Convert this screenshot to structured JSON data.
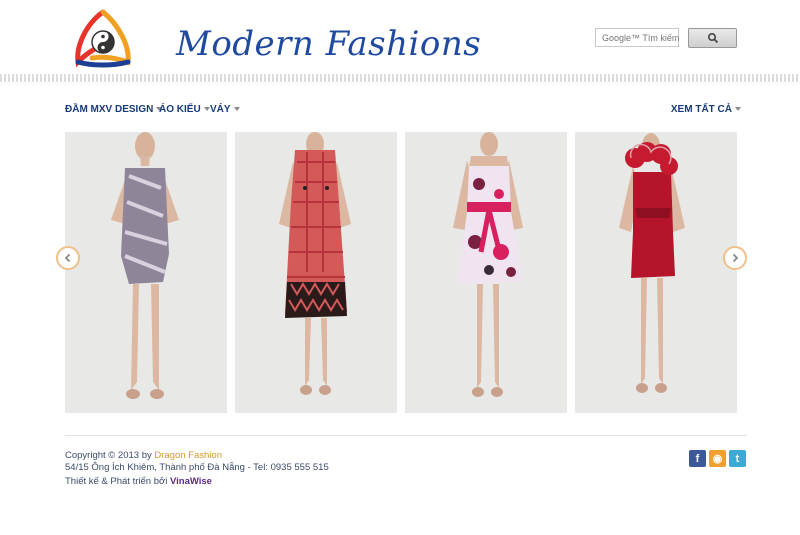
{
  "brand": {
    "name": "Modern Fashions"
  },
  "search": {
    "placeholder": "Google™ Tìm kiếm"
  },
  "nav": {
    "items": [
      {
        "label": "ĐẦM MXV DESIGN"
      },
      {
        "label": "ÁO KIỂU"
      },
      {
        "label": "VÁY"
      }
    ],
    "view_all": "XEM TẤT CẢ"
  },
  "gallery": {
    "items": [
      {
        "name": "strapless-print-dress",
        "colors": {
          "dress": "#8f8598",
          "accent": "#d7d2dd"
        }
      },
      {
        "name": "red-plaid-dress",
        "colors": {
          "dress": "#d45a5a",
          "accent": "#2b1a1a"
        }
      },
      {
        "name": "floral-sash-dress",
        "colors": {
          "dress": "#efe4ef",
          "accent": "#d8205e"
        }
      },
      {
        "name": "red-ruffle-dress",
        "colors": {
          "dress": "#b5142a",
          "accent": "#e0a3aa"
        }
      }
    ]
  },
  "footer": {
    "copyright_prefix": "Copyright © 2013 by",
    "company": "Dragon Fashion",
    "address": "54/15 Ông Ích Khiêm, Thành phố Đà Nẵng - Tel: 0935 555 515",
    "design_prefix": "Thiết kế & Phát triển bởi",
    "designer": "VinaWise"
  },
  "social": [
    {
      "icon": "facebook-icon",
      "glyph": "f",
      "color": "#3b5998"
    },
    {
      "icon": "rss-icon",
      "glyph": "◉",
      "color": "#f0a030"
    },
    {
      "icon": "twitter-icon",
      "glyph": "t",
      "color": "#3fa9d6"
    }
  ]
}
